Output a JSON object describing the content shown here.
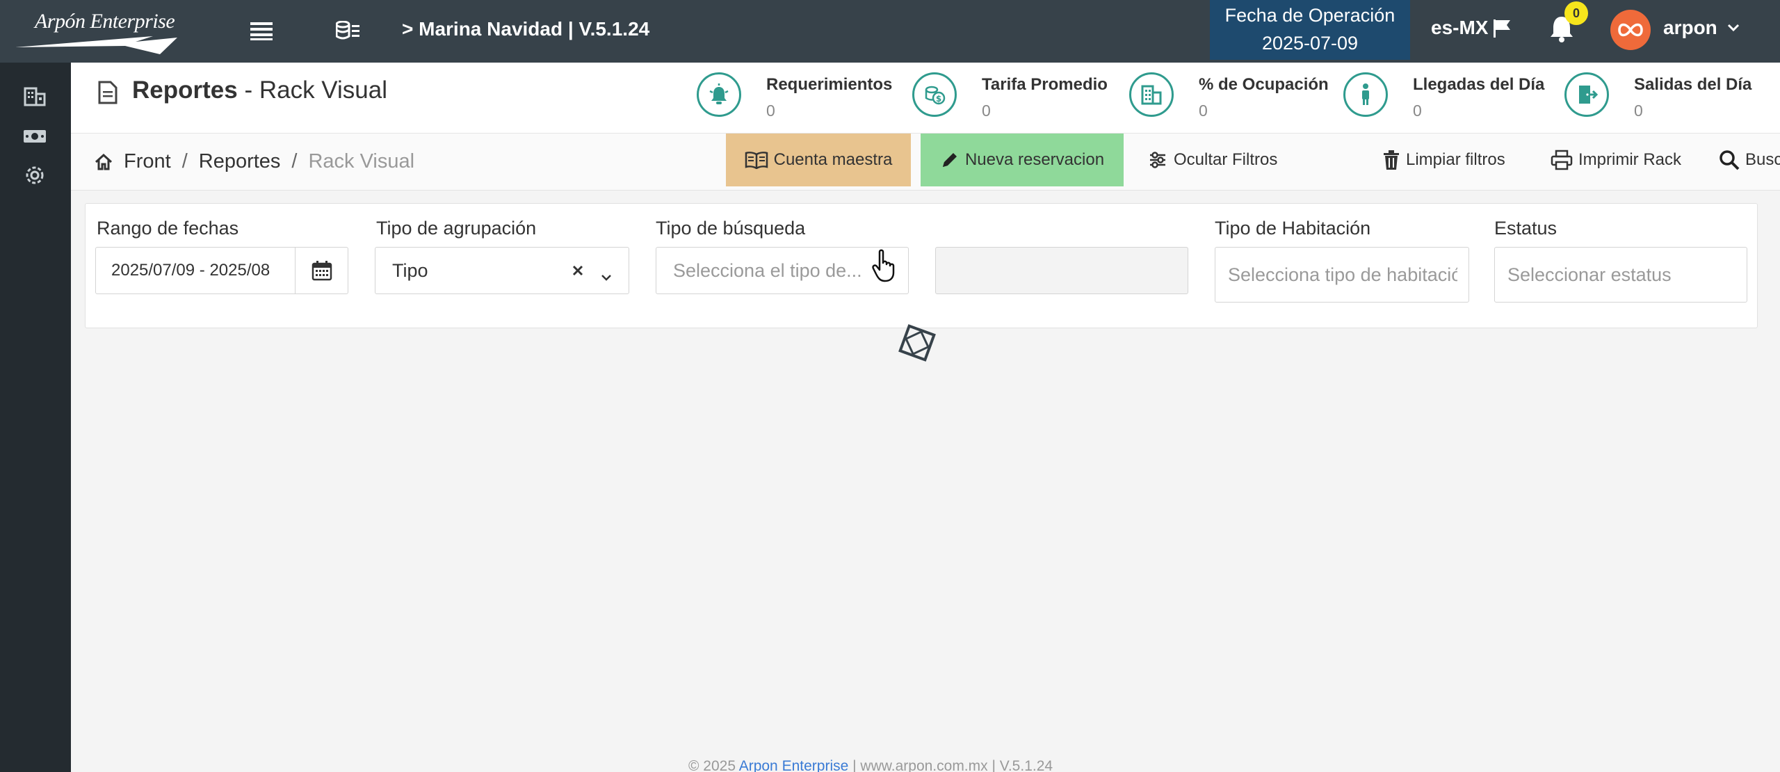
{
  "topbar": {
    "logo_text": "Arpón Enterprise",
    "hotel_label": "> Marina Navidad | V.5.1.24",
    "op_date_label": "Fecha de Operación",
    "op_date_value": "2025-07-09",
    "language": "es-MX",
    "notifications_count": "0",
    "username": "arpon",
    "colors": {
      "bar": "#37424a",
      "op_date_bg": "#1e4a6e",
      "badge": "#f7e51c",
      "avatar": "#ef6a3a"
    }
  },
  "sidebar": {
    "items": [
      {
        "icon": "building-icon"
      },
      {
        "icon": "money-icon"
      },
      {
        "icon": "gear-icon"
      }
    ]
  },
  "header": {
    "title_bold": "Reportes",
    "title_rest": " - Rack Visual",
    "kpis": [
      {
        "label": "Requerimientos",
        "value": "0",
        "icon": "bell-alarm-icon"
      },
      {
        "label": "Tarifa Promedio",
        "value": "0",
        "icon": "coins-icon"
      },
      {
        "label": "% de Ocupación",
        "value": "0",
        "icon": "building-icon"
      },
      {
        "label": "Llegadas del Día",
        "value": "0",
        "icon": "person-icon"
      },
      {
        "label": "Salidas del Día",
        "value": "0",
        "icon": "door-exit-icon"
      }
    ]
  },
  "breadcrumb": {
    "items": [
      "Front",
      "Reportes",
      "Rack Visual"
    ],
    "separator": "/"
  },
  "toolbar": {
    "cuenta_maestra": "Cuenta maestra",
    "nueva_reservacion": "Nueva reservacion",
    "ocultar_filtros": "Ocultar Filtros",
    "limpiar_filtros": "Limpiar filtros",
    "imprimir_rack": "Imprimir Rack",
    "buscar": "Buscar",
    "colors": {
      "cuenta": "#e8c48f",
      "nueva": "#8fd99a"
    }
  },
  "filters": {
    "rango_label": "Rango de fechas",
    "rango_value": "2025/07/09 - 2025/08",
    "agrupacion_label": "Tipo de agrupación",
    "agrupacion_value": "Tipo",
    "busqueda_label": "Tipo de búsqueda",
    "busqueda_placeholder": "Selecciona el tipo de...",
    "habitacion_label": "Tipo de Habitación",
    "habitacion_placeholder": "Selecciona tipo de habitación",
    "estatus_label": "Estatus",
    "estatus_placeholder": "Seleccionar estatus"
  },
  "footer": {
    "prefix": "© 2025 ",
    "link": "Arpon Enterprise",
    "suffix": " | www.arpon.com.mx | V.5.1.24"
  }
}
